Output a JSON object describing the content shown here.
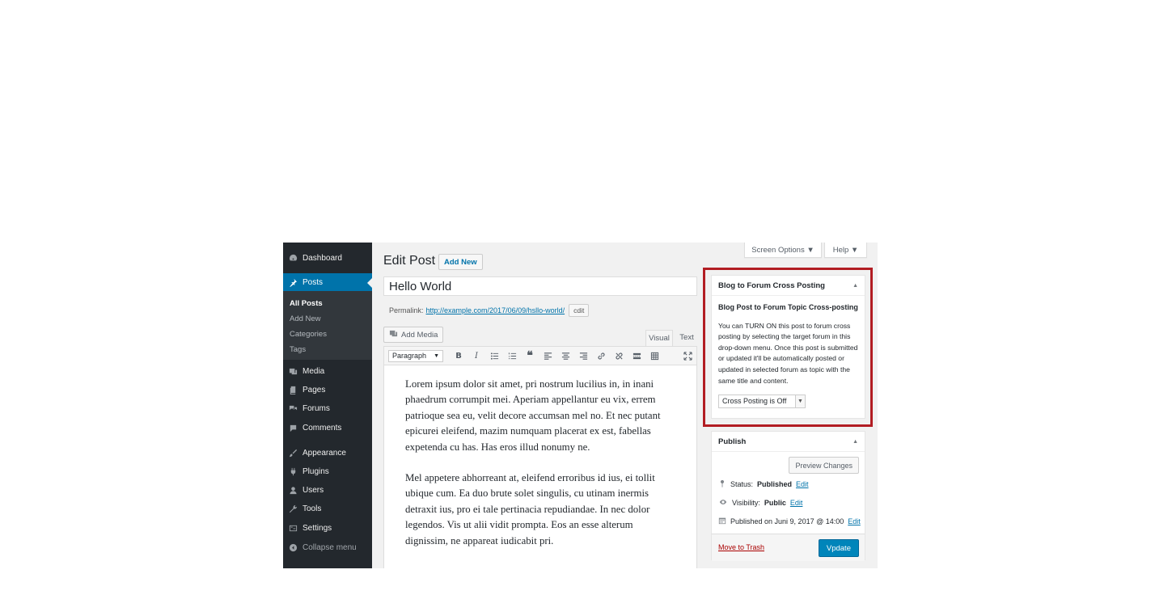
{
  "sidebar": {
    "dashboard": "Dashboard",
    "posts": "Posts",
    "submenu": [
      "All Posts",
      "Add New",
      "Categories",
      "Tags"
    ],
    "media": "Media",
    "pages": "Pages",
    "forums": "Forums",
    "comments": "Comments",
    "appearance": "Appearance",
    "plugins": "Plugins",
    "users": "Users",
    "tools": "Tools",
    "settings": "Settings",
    "collapse": "Collapse menu"
  },
  "top": {
    "screen_options": "Screen Options ▼",
    "help": "Help ▼"
  },
  "header": {
    "title": "Edit Post",
    "add_new": "Add New"
  },
  "post": {
    "title": "Hello World",
    "permalink_label": "Permalink:",
    "permalink_url": "http://example.com/2017/06/09/hsllo-world/",
    "permalink_edit": "cdit"
  },
  "editor": {
    "add_media": "Add Media",
    "tab_visual": "Visual",
    "tab_text": "Text",
    "format": "Paragraph",
    "paragraphs": [
      "Lorem ipsum dolor sit amet, pri nostrum lucilius in, in inani phaedrum corrumpit mei. Aperiam appellantur eu vix, errem patrioque sea eu, velit decore accumsan mel no. Et nec putant epicurei eleifend, mazim numquam placerat ex est, fabellas expetenda cu has. Has eros illud nonumy ne.",
      "Mel appetere abhorreant at, eleifend erroribus id ius, ei tollit ubique cum. Ea duo brute solet singulis, cu utinam inermis detraxit ius, pro ei tale pertinacia repudiandae. In nec dolor legendos. Vis ut alii vidit prompta. Eos an esse alterum dignissim, ne appareat iudicabit pri."
    ]
  },
  "cross_posting": {
    "heading": "Blog to Forum Cross Posting",
    "subtitle": "Blog Post to Forum Topic Cross-posting",
    "description": "You can TURN ON this post to forum cross posting by selecting the target forum in this drop-down menu. Once this post is submitted or updated it'll be automatically posted or updated in selected forum as topic with the same title and content.",
    "select_value": "Cross Posting is Off"
  },
  "publish": {
    "heading": "Publish",
    "preview": "Preview Changes",
    "status_label": "Status:",
    "status_value": "Published",
    "visibility_label": "Visibility:",
    "visibility_value": "Public",
    "published_on": "Published on Juni 9, 2017 @ 14:00",
    "edit": "Edit",
    "trash": "Move to Trash",
    "update": "Vpdate"
  },
  "colors": {
    "accent": "#0073aa",
    "sidebar": "#23282d",
    "highlight": "#b21d23",
    "primary_button": "#0085ba"
  }
}
